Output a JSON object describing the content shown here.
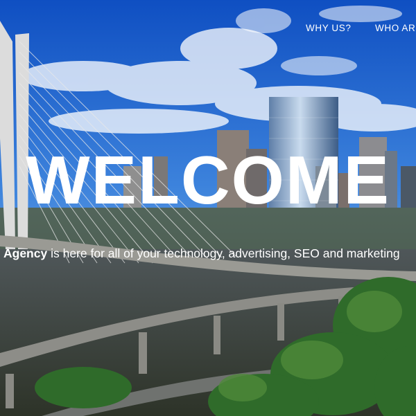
{
  "nav": {
    "items": [
      {
        "label": "WHY US?"
      },
      {
        "label": "WHO AR"
      }
    ]
  },
  "hero": {
    "headline": "WELCOME",
    "tagline_brand": "Agency",
    "tagline_rest": " is here for all of your technology, advertising, SEO and marketing"
  },
  "colors": {
    "sky_top": "#1456c8",
    "sky_mid": "#4f8fe0",
    "text": "#ffffff",
    "foliage": "#2f6b2a"
  }
}
